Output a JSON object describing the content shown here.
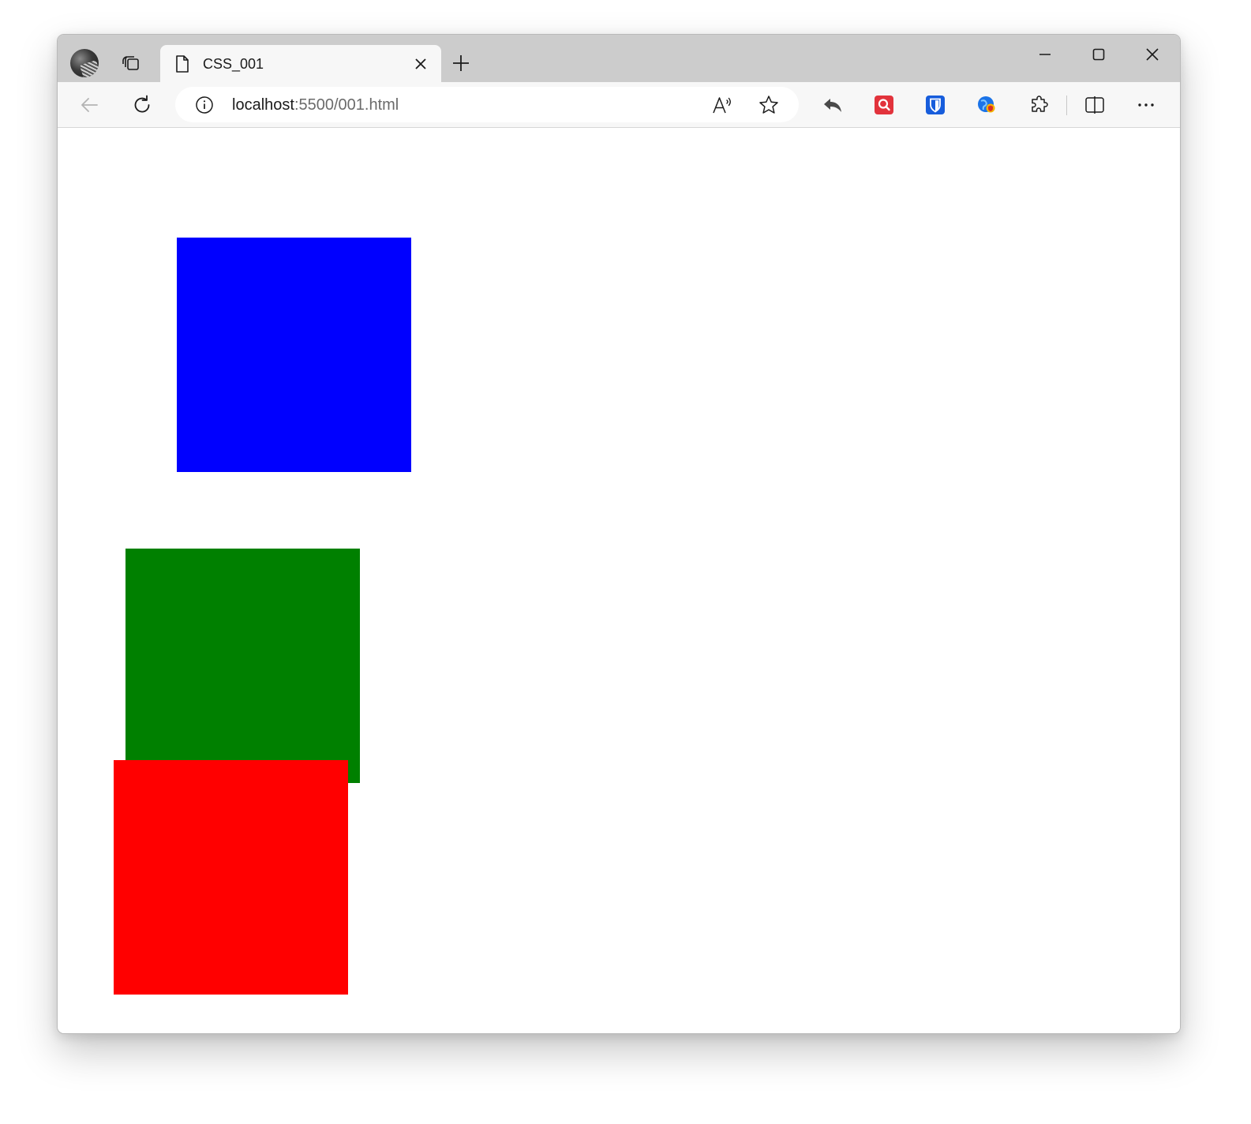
{
  "browser": {
    "tab": {
      "title": "CSS_001"
    },
    "address_bar": {
      "url_host": "localhost",
      "url_rest": ":5500/001.html"
    },
    "icons": {
      "profile": "profile-avatar",
      "tab_actions": "tab-actions-icon",
      "page": "page-icon",
      "close_tab": "close-icon",
      "new_tab": "plus-icon",
      "minimize": "minimize-icon",
      "maximize": "maximize-icon",
      "close_window": "close-icon",
      "back": "back-arrow-icon",
      "refresh": "refresh-icon",
      "site_info": "info-icon",
      "read_aloud": "read-aloud-icon",
      "favorite": "star-icon",
      "share": "reply-arrow-icon",
      "extension_search": "search-extension-icon",
      "extension_bitwarden": "bitwarden-shield-icon",
      "extension_globe": "globe-extension-icon",
      "extensions": "puzzle-icon",
      "split_screen": "split-screen-icon",
      "more": "more-icon"
    },
    "colors": {
      "titlebar": "#cccccc",
      "toolbar": "#f7f7f7",
      "tab_active": "#f7f7f7",
      "search_ext": "#e2333c",
      "bitwarden": "#175ddc"
    }
  },
  "page": {
    "boxes": [
      {
        "name": "blue-box",
        "color": "#0000ff"
      },
      {
        "name": "green-box",
        "color": "#008000"
      },
      {
        "name": "red-box",
        "color": "#ff0000"
      }
    ]
  }
}
